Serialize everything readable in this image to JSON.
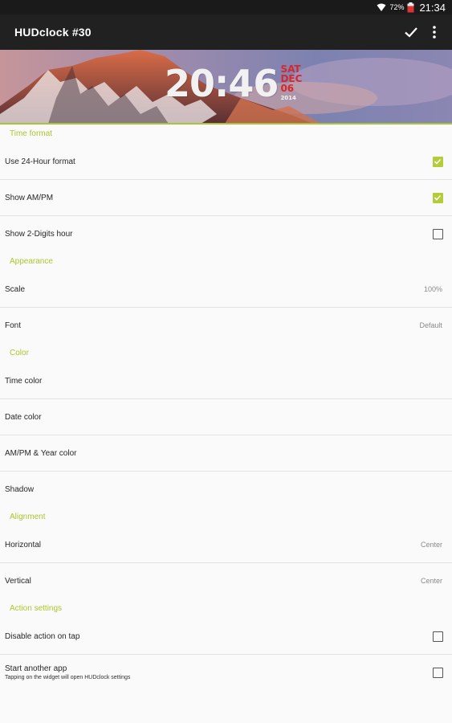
{
  "status_bar": {
    "battery_percent": "72%",
    "time": "21:34"
  },
  "app_bar": {
    "title": "HUDclock #30"
  },
  "preview": {
    "time": "20:46",
    "day": "SAT",
    "month": "DEC",
    "date": "06",
    "year": "2014"
  },
  "sections": {
    "time_format": {
      "header": "Time format",
      "use_24_hour": {
        "label": "Use 24-Hour format",
        "checked": true
      },
      "show_ampm": {
        "label": "Show AM/PM",
        "checked": true
      },
      "show_2digits": {
        "label": "Show 2-Digits hour",
        "checked": false
      }
    },
    "appearance": {
      "header": "Appearance",
      "scale": {
        "label": "Scale",
        "value": "100%"
      },
      "font": {
        "label": "Font",
        "value": "Default"
      }
    },
    "color": {
      "header": "Color",
      "time_color": {
        "label": "Time color"
      },
      "date_color": {
        "label": "Date color"
      },
      "ampm_year_color": {
        "label": "AM/PM & Year color"
      },
      "shadow": {
        "label": "Shadow"
      }
    },
    "alignment": {
      "header": "Alignment",
      "horizontal": {
        "label": "Horizontal",
        "value": "Center"
      },
      "vertical": {
        "label": "Vertical",
        "value": "Center"
      }
    },
    "action_settings": {
      "header": "Action settings",
      "disable_action": {
        "label": "Disable action on tap",
        "checked": false
      },
      "start_app": {
        "label": "Start another app",
        "subtitle": "Tapping on the widget will open HUDclock settings",
        "checked": false
      }
    }
  },
  "colors": {
    "accent": "#a9c72f",
    "app_bar": "#212121",
    "status_bar": "#1a1a1a",
    "date_red": "#d8262b"
  }
}
